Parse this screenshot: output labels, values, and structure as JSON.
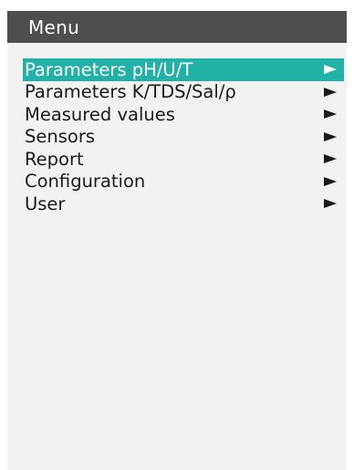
{
  "header": {
    "title": "Menu"
  },
  "menu": {
    "selected_index": 0,
    "items": [
      {
        "label": "Parameters pH/U/T",
        "icon": "arrow-right-icon"
      },
      {
        "label": "Parameters K/TDS/Sal/ρ",
        "icon": "arrow-right-icon"
      },
      {
        "label": "Measured values",
        "icon": "arrow-right-icon"
      },
      {
        "label": "Sensors",
        "icon": "arrow-right-icon"
      },
      {
        "label": "Report",
        "icon": "arrow-right-icon"
      },
      {
        "label": "Configuration",
        "icon": "arrow-right-icon"
      },
      {
        "label": "User",
        "icon": "arrow-right-icon"
      }
    ]
  },
  "colors": {
    "title_bar": "#4e4e4e",
    "selection": "#22b1a7",
    "screen_background": "#f2f2f2",
    "text": "#1a1a1a"
  }
}
